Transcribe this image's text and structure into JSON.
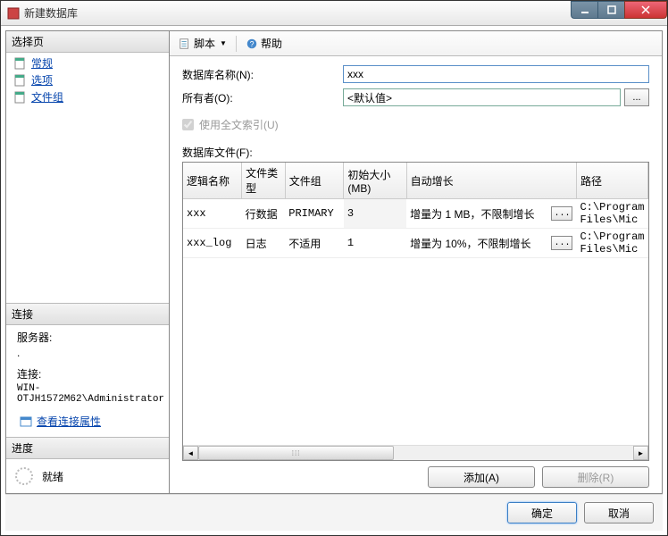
{
  "window": {
    "title": "新建数据库"
  },
  "sidebar": {
    "select_page_header": "选择页",
    "items": [
      "常规",
      "选项",
      "文件组"
    ],
    "connection_header": "连接",
    "server_label": "服务器:",
    "server_value": ".",
    "conn_label": "连接:",
    "conn_value": "WIN-OTJH1572M62\\Administrator",
    "view_props": "查看连接属性",
    "progress_header": "进度",
    "progress_status": "就绪"
  },
  "toolbar": {
    "script": "脚本",
    "help": "帮助"
  },
  "form": {
    "db_name_label": "数据库名称(N):",
    "db_name_value": "xxx",
    "owner_label": "所有者(O):",
    "owner_value": "<默认值>",
    "fulltext_label": "使用全文索引(U)",
    "files_label": "数据库文件(F):"
  },
  "table": {
    "headers": {
      "logical_name": "逻辑名称",
      "file_type": "文件类型",
      "file_group": "文件组",
      "initial_size": "初始大小(MB)",
      "auto_grow": "自动增长",
      "path": "路径"
    },
    "rows": [
      {
        "name": "xxx",
        "type": "行数据",
        "group": "PRIMARY",
        "size": "3",
        "grow": "增量为 1 MB，不限制增长",
        "btn": "...",
        "path": "C:\\Program Files\\Mic"
      },
      {
        "name": "xxx_log",
        "type": "日志",
        "group": "不适用",
        "size": "1",
        "grow": "增量为 10%，不限制增长",
        "btn": "...",
        "path": "C:\\Program Files\\Mic"
      }
    ]
  },
  "buttons": {
    "add": "添加(A)",
    "remove": "删除(R)",
    "ok": "确定",
    "cancel": "取消",
    "browse": "..."
  }
}
